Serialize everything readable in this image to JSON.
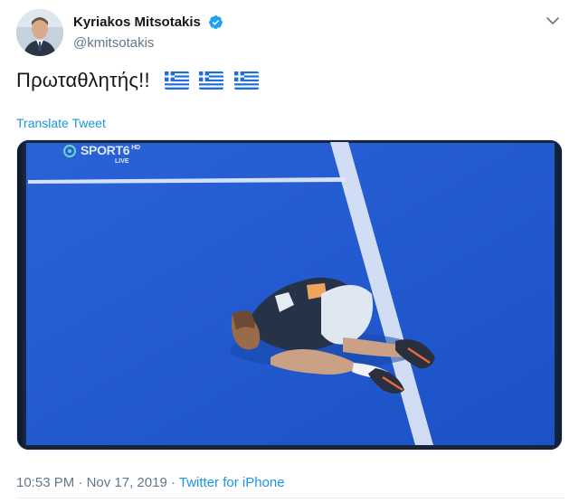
{
  "author": {
    "display_name": "Kyriakos Mitsotakis",
    "handle": "@kmitsotakis",
    "verified": true,
    "avatar_icon": "profile-photo"
  },
  "tweet": {
    "text": "Πρωταθλητής!!",
    "emoji": [
      "greek-flag",
      "greek-flag",
      "greek-flag"
    ],
    "translate_label": "Translate Tweet"
  },
  "media": {
    "broadcaster_logo": "SPORT6",
    "broadcaster_suffix": "HD",
    "live_label": "LIVE",
    "description_icon": "tennis-player-on-court"
  },
  "meta": {
    "time": "10:53 PM",
    "separator": "·",
    "date": "Nov 17, 2019",
    "source": "Twitter for iPhone"
  },
  "colors": {
    "link": "#1b95e0",
    "secondary_text": "#657786",
    "court_blue": "#1f5cd6",
    "verified_badge": "#1da1f2"
  }
}
